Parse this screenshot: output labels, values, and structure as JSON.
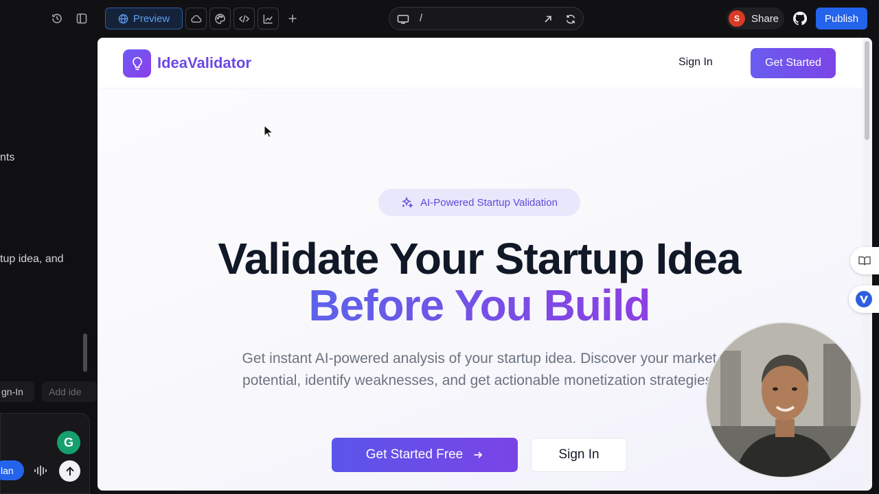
{
  "toolbar": {
    "preview_label": "Preview",
    "url_path": "/",
    "share_label": "Share",
    "share_avatar_letter": "S",
    "publish_label": "Publish",
    "accent_color": "#2463eb"
  },
  "left_panel": {
    "text_line1": "nts",
    "text_line2": "tup idea, and",
    "chips": [
      "gn-In",
      "Add ide"
    ],
    "plan_label": "lan"
  },
  "site": {
    "brand": "IdeaValidator",
    "nav": {
      "signin_label": "Sign In",
      "getstarted_label": "Get Started"
    },
    "hero": {
      "badge": "AI-Powered Startup Validation",
      "title_line1": "Validate Your Startup Idea",
      "title_line2": "Before You Build",
      "subtitle": "Get instant AI-powered analysis of your startup idea. Discover your market potential, identify weaknesses, and get actionable monetization strategies.",
      "cta_primary": "Get Started Free",
      "cta_secondary": "Sign In"
    },
    "brand_gradient": [
      "#6d5cf5",
      "#8b3ee8"
    ]
  }
}
